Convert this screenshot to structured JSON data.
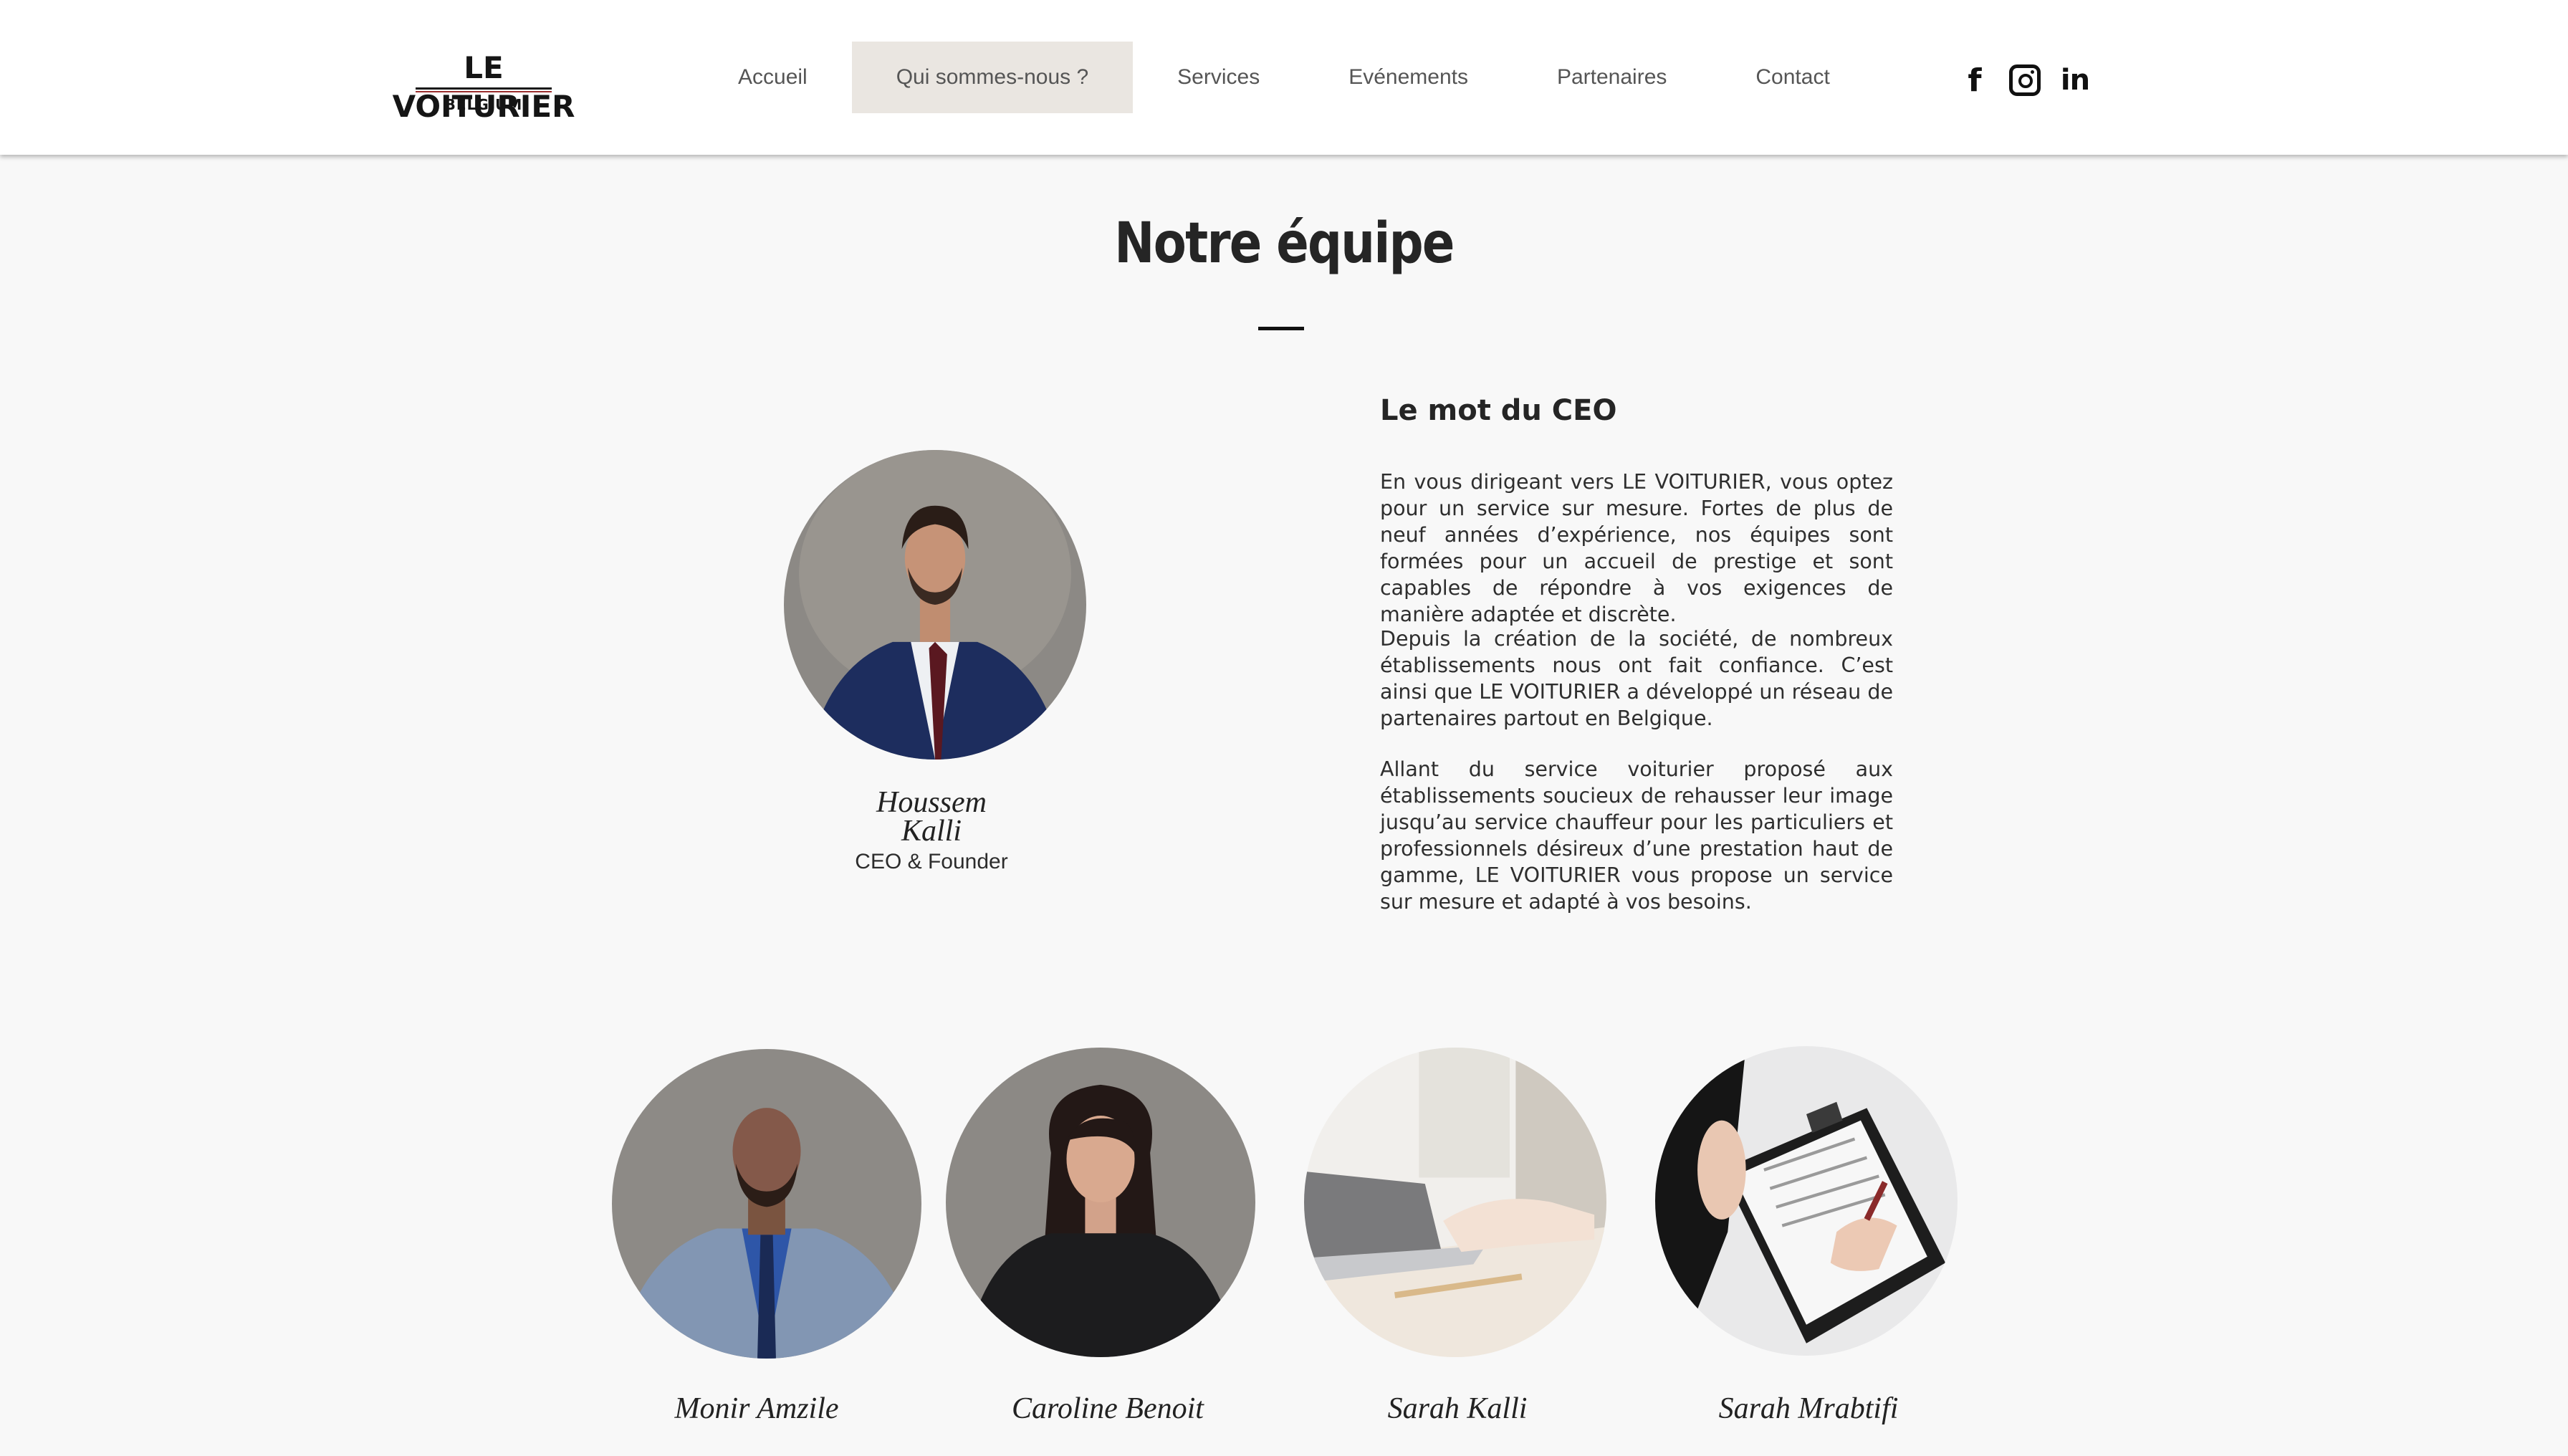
{
  "header": {
    "logo": {
      "name": "LE VOITURIER",
      "sub": "BELGIUM"
    },
    "nav": [
      {
        "label": "Accueil",
        "active": false
      },
      {
        "label": "Qui sommes-nous ?",
        "active": true
      },
      {
        "label": "Services",
        "active": false
      },
      {
        "label": "Evénements",
        "active": false
      },
      {
        "label": "Partenaires",
        "active": false
      },
      {
        "label": "Contact",
        "active": false
      }
    ],
    "social": [
      "facebook-icon",
      "instagram-icon",
      "linkedin-icon"
    ],
    "active_color": "#eae6e1"
  },
  "team": {
    "title": "Notre équipe",
    "ceo": {
      "name_line1": "Houssem",
      "name_line2": "Kalli",
      "role": "CEO & Founder"
    },
    "message": {
      "heading": "Le mot du CEO",
      "paragraphs": [
        "En vous dirigeant vers LE VOITURIER, vous optez pour un service sur mesure. Fortes de plus de neuf années d’expérience, nos équipes sont formées pour un accueil de prestige et sont capables de répondre à vos exigences de manière adaptée et discrète.",
        "Depuis la création de la société, de nombreux établissements nous ont fait confiance. C’est ainsi que LE VOITURIER a développé un réseau de partenaires partout en Belgique.",
        "Allant du service voiturier proposé aux établissements soucieux de rehausser leur image jusqu’au service chauffeur pour les particuliers et professionnels désireux d’une prestation haut de gamme, LE VOITURIER vous propose un service sur mesure et adapté à vos besoins."
      ]
    },
    "members": [
      {
        "name": "Monir Amzile"
      },
      {
        "name": "Caroline Benoit"
      },
      {
        "name": "Sarah Kalli"
      },
      {
        "name": "Sarah Mrabtifi"
      }
    ]
  }
}
